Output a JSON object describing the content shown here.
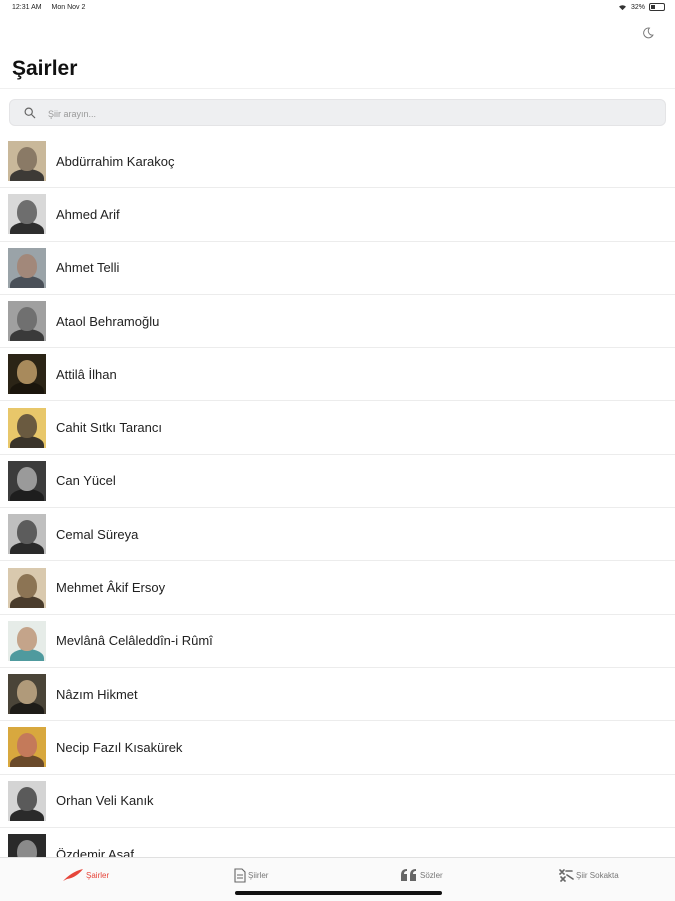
{
  "status_bar": {
    "time": "12:31 AM",
    "date": "Mon Nov 2",
    "battery": "32%",
    "battery_level": 0.32
  },
  "header": {
    "title": "Şairler",
    "theme_toggle_icon": "moon-icon"
  },
  "search": {
    "placeholder": "Şiir arayın..."
  },
  "poets": [
    {
      "name": "Abdürrahim Karakoç",
      "bg": "#c9b89a",
      "face": "#8a7a66",
      "body": "#3d3a36"
    },
    {
      "name": "Ahmed Arif",
      "bg": "#d8d8d8",
      "face": "#6e6e6e",
      "body": "#2e2e2e"
    },
    {
      "name": "Ahmet Telli",
      "bg": "#9aa3a8",
      "face": "#a2887a",
      "body": "#4a5058"
    },
    {
      "name": "Ataol Behramoğlu",
      "bg": "#a0a0a0",
      "face": "#707070",
      "body": "#3a3a3a"
    },
    {
      "name": "Attilâ İlhan",
      "bg": "#2b2416",
      "face": "#a88a5c",
      "body": "#1a150c"
    },
    {
      "name": "Cahit Sıtkı Tarancı",
      "bg": "#e8c76a",
      "face": "#6a5a40",
      "body": "#3a342a"
    },
    {
      "name": "Can Yücel",
      "bg": "#3c3c3c",
      "face": "#9a9a9a",
      "body": "#1e1e1e"
    },
    {
      "name": "Cemal Süreya",
      "bg": "#bfbfbf",
      "face": "#5c5c5c",
      "body": "#2a2a2a"
    },
    {
      "name": "Mehmet Âkif Ersoy",
      "bg": "#d9c9ae",
      "face": "#8c7454",
      "body": "#4a3c2c"
    },
    {
      "name": "Mevlânâ Celâleddîn-i Rûmî",
      "bg": "#e6ece8",
      "face": "#c4a48a",
      "body": "#4f9a9e"
    },
    {
      "name": "Nâzım Hikmet",
      "bg": "#4a4438",
      "face": "#b09a7a",
      "body": "#1e1c18"
    },
    {
      "name": "Necip Fazıl Kısakürek",
      "bg": "#d8a83e",
      "face": "#c47a5a",
      "body": "#6a4a2a"
    },
    {
      "name": "Orhan Veli Kanık",
      "bg": "#d4d4d4",
      "face": "#5a5a5a",
      "body": "#2a2a2a"
    },
    {
      "name": "Özdemir Asaf",
      "bg": "#2a2a2a",
      "face": "#8a8a8a",
      "body": "#111111"
    }
  ],
  "tabs": [
    {
      "label": "Şairler",
      "icon": "feather-icon",
      "active": true
    },
    {
      "label": "Şiirler",
      "icon": "document-icon",
      "active": false
    },
    {
      "label": "Sözler",
      "icon": "quote-icon",
      "active": false
    },
    {
      "label": "Şiir Sokakta",
      "icon": "street-art-icon",
      "active": false
    }
  ],
  "colors": {
    "accent": "#e6453a",
    "background": "#ffffff",
    "search_bg": "#eeeff1"
  }
}
